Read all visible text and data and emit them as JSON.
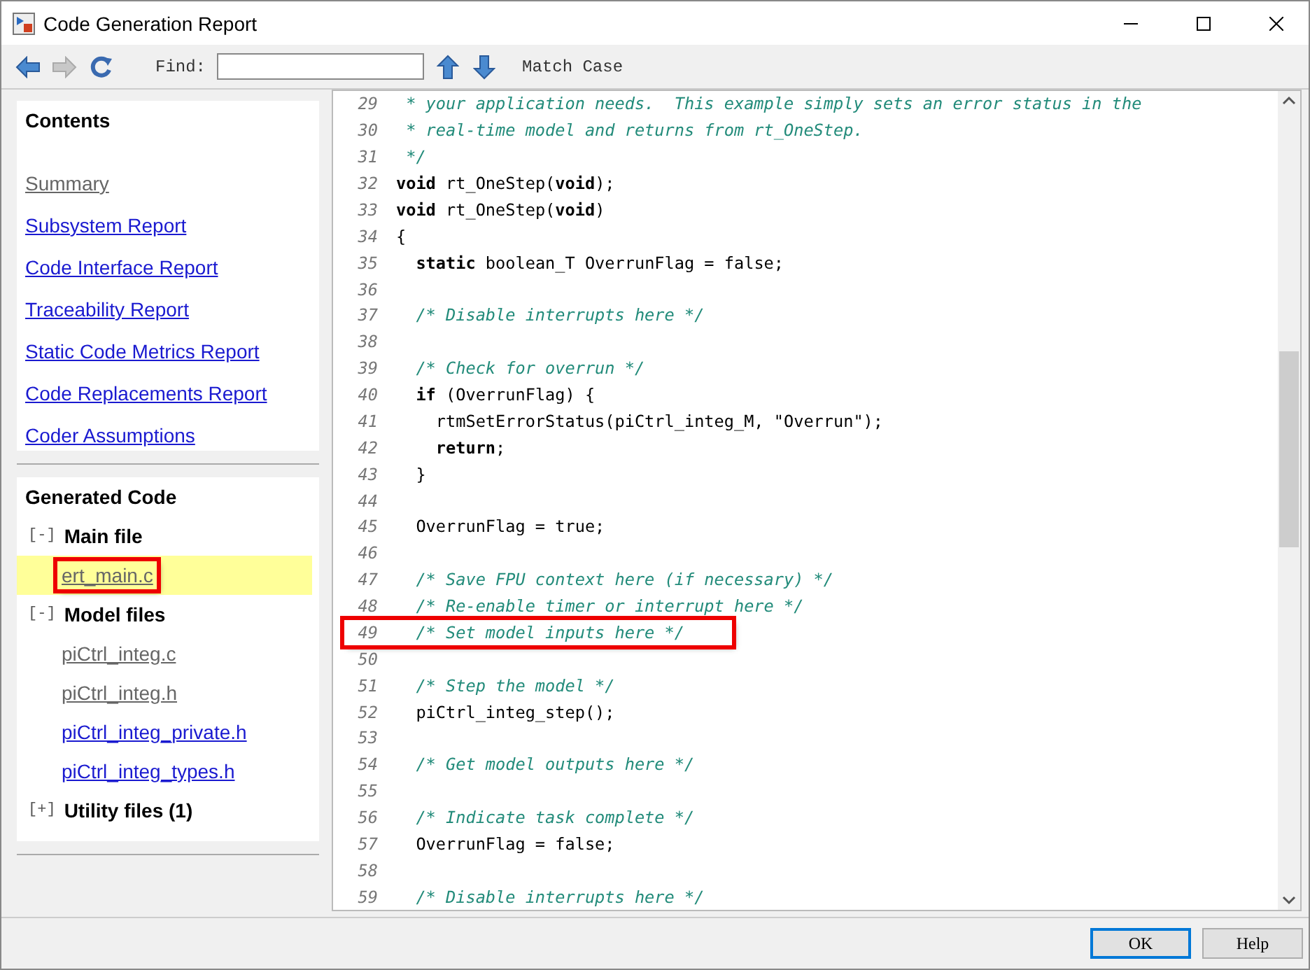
{
  "window": {
    "title": "Code Generation Report"
  },
  "toolbar": {
    "back": {
      "disabled": false
    },
    "forward": {
      "disabled": true
    },
    "find_label": "Find:",
    "match_case": "Match Case"
  },
  "contents": {
    "heading": "Contents",
    "links": [
      {
        "label": "Summary",
        "visited": true
      },
      {
        "label": "Subsystem Report",
        "visited": false
      },
      {
        "label": "Code Interface Report",
        "visited": false
      },
      {
        "label": "Traceability Report",
        "visited": false
      },
      {
        "label": "Static Code Metrics Report",
        "visited": false
      },
      {
        "label": "Code Replacements Report",
        "visited": false
      },
      {
        "label": "Coder Assumptions",
        "visited": false
      }
    ]
  },
  "generated_code": {
    "heading": "Generated Code",
    "groups": [
      {
        "toggle": "[-]",
        "label": "Main file",
        "files": [
          {
            "label": "ert_main.c",
            "visited": true,
            "highlighted": true,
            "annotated": true
          }
        ]
      },
      {
        "toggle": "[-]",
        "label": "Model files",
        "files": [
          {
            "label": "piCtrl_integ.c",
            "visited": true,
            "highlighted": false,
            "annotated": false
          },
          {
            "label": "piCtrl_integ.h",
            "visited": true,
            "highlighted": false,
            "annotated": false
          },
          {
            "label": "piCtrl_integ_private.h",
            "visited": false,
            "highlighted": false,
            "annotated": false
          },
          {
            "label": "piCtrl_integ_types.h",
            "visited": false,
            "highlighted": false,
            "annotated": false
          }
        ]
      },
      {
        "toggle": "[+]",
        "label": "Utility files (1)"
      }
    ]
  },
  "code": {
    "lines": [
      {
        "number": "29",
        "annotated": false,
        "segments": [
          {
            "kind": "comment",
            "text": " * your application needs.  This example simply sets an error status in the"
          }
        ]
      },
      {
        "number": "30",
        "annotated": false,
        "segments": [
          {
            "kind": "comment",
            "text": " * real-time model and returns from rt_OneStep."
          }
        ]
      },
      {
        "number": "31",
        "annotated": false,
        "segments": [
          {
            "kind": "comment",
            "text": " */"
          }
        ]
      },
      {
        "number": "32",
        "annotated": false,
        "segments": [
          {
            "kind": "keyword",
            "text": "void"
          },
          {
            "kind": "plain",
            "text": " rt_OneStep("
          },
          {
            "kind": "keyword",
            "text": "void"
          },
          {
            "kind": "plain",
            "text": ");"
          }
        ]
      },
      {
        "number": "33",
        "annotated": false,
        "segments": [
          {
            "kind": "keyword",
            "text": "void"
          },
          {
            "kind": "plain",
            "text": " rt_OneStep("
          },
          {
            "kind": "keyword",
            "text": "void"
          },
          {
            "kind": "plain",
            "text": ")"
          }
        ]
      },
      {
        "number": "34",
        "annotated": false,
        "segments": [
          {
            "kind": "plain",
            "text": "{"
          }
        ]
      },
      {
        "number": "35",
        "annotated": false,
        "segments": [
          {
            "kind": "keyword",
            "text": "  static"
          },
          {
            "kind": "plain",
            "text": " boolean_T OverrunFlag = false;"
          }
        ]
      },
      {
        "number": "36",
        "annotated": false
      },
      {
        "number": "37",
        "annotated": false,
        "segments": [
          {
            "kind": "comment",
            "text": "  /* Disable interrupts here */"
          }
        ]
      },
      {
        "number": "38",
        "annotated": false
      },
      {
        "number": "39",
        "annotated": false,
        "segments": [
          {
            "kind": "comment",
            "text": "  /* Check for overrun */"
          }
        ]
      },
      {
        "number": "40",
        "annotated": false,
        "segments": [
          {
            "kind": "keyword",
            "text": "  if"
          },
          {
            "kind": "plain",
            "text": " (OverrunFlag) {"
          }
        ]
      },
      {
        "number": "41",
        "annotated": false,
        "segments": [
          {
            "kind": "plain",
            "text": "    rtmSetErrorStatus(piCtrl_integ_M, \"Overrun\");"
          }
        ]
      },
      {
        "number": "42",
        "annotated": false,
        "segments": [
          {
            "kind": "keyword",
            "text": "    return"
          },
          {
            "kind": "plain",
            "text": ";"
          }
        ]
      },
      {
        "number": "43",
        "annotated": false,
        "segments": [
          {
            "kind": "plain",
            "text": "  }"
          }
        ]
      },
      {
        "number": "44",
        "annotated": false
      },
      {
        "number": "45",
        "annotated": false,
        "segments": [
          {
            "kind": "plain",
            "text": "  OverrunFlag = true;"
          }
        ]
      },
      {
        "number": "46",
        "annotated": false
      },
      {
        "number": "47",
        "annotated": false,
        "segments": [
          {
            "kind": "comment",
            "text": "  /* Save FPU context here (if necessary) */"
          }
        ]
      },
      {
        "number": "48",
        "annotated": false,
        "segments": [
          {
            "kind": "comment",
            "text": "  /* Re-enable timer or interrupt here */"
          }
        ]
      },
      {
        "number": "49",
        "annotated": true,
        "segments": [
          {
            "kind": "comment",
            "text": "  /* Set model inputs here */"
          }
        ]
      },
      {
        "number": "50",
        "annotated": false
      },
      {
        "number": "51",
        "annotated": false,
        "segments": [
          {
            "kind": "comment",
            "text": "  /* Step the model */"
          }
        ]
      },
      {
        "number": "52",
        "annotated": false,
        "segments": [
          {
            "kind": "plain",
            "text": "  piCtrl_integ_step();"
          }
        ]
      },
      {
        "number": "53",
        "annotated": false
      },
      {
        "number": "54",
        "annotated": false,
        "segments": [
          {
            "kind": "comment",
            "text": "  /* Get model outputs here */"
          }
        ]
      },
      {
        "number": "55",
        "annotated": false
      },
      {
        "number": "56",
        "annotated": false,
        "segments": [
          {
            "kind": "comment",
            "text": "  /* Indicate task complete */"
          }
        ]
      },
      {
        "number": "57",
        "annotated": false,
        "segments": [
          {
            "kind": "plain",
            "text": "  OverrunFlag = false;"
          }
        ]
      },
      {
        "number": "58",
        "annotated": false
      },
      {
        "number": "59",
        "annotated": false,
        "segments": [
          {
            "kind": "comment",
            "text": "  /* Disable interrupts here */"
          }
        ]
      }
    ]
  },
  "buttons": [
    {
      "label": "OK",
      "selected": true
    },
    {
      "label": "Help",
      "selected": false
    }
  ]
}
